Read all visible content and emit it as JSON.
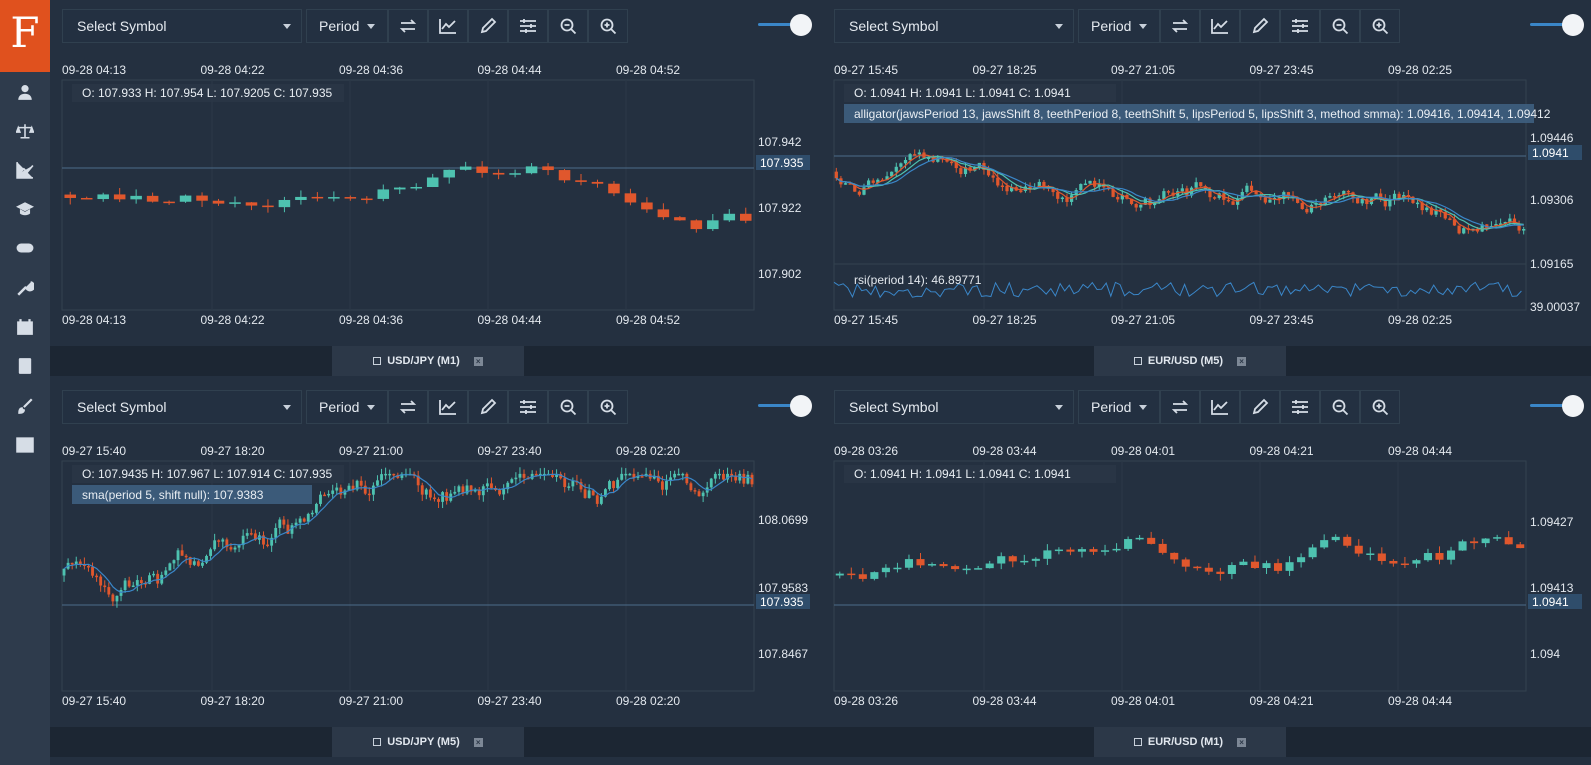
{
  "app": {
    "logo_letter": "F"
  },
  "sidebar": {
    "items": [
      {
        "name": "user",
        "icon": "user-icon"
      },
      {
        "name": "balance",
        "icon": "scale-icon"
      },
      {
        "name": "chart",
        "icon": "line-chart-icon"
      },
      {
        "name": "education",
        "icon": "graduation-cap-icon"
      },
      {
        "name": "games",
        "icon": "gamepad-icon"
      },
      {
        "name": "tools",
        "icon": "wrench-icon"
      },
      {
        "name": "calendar",
        "icon": "calendar-icon"
      },
      {
        "name": "book",
        "icon": "book-icon"
      },
      {
        "name": "paint",
        "icon": "brush-icon"
      },
      {
        "name": "table",
        "icon": "table-icon"
      }
    ]
  },
  "toolbar": {
    "symbol_placeholder": "Select Symbol",
    "period_label": "Period",
    "buttons": [
      "swap-icon",
      "area-chart-icon",
      "pencil-icon",
      "sliders-icon",
      "zoom-out-icon",
      "zoom-in-icon"
    ]
  },
  "colors": {
    "up": "#4ec2b0",
    "down": "#e0572d",
    "accent": "#e0511e",
    "line": "#3a86c8"
  },
  "charts": [
    {
      "id": "p1",
      "tab": "USD/JPY (M1)",
      "top_times": [
        "09-28 04:13",
        "09-28 04:22",
        "09-28 04:36",
        "09-28 04:44",
        "09-28 04:52"
      ],
      "bottom_times": [
        "09-28 04:13",
        "09-28 04:22",
        "09-28 04:36",
        "09-28 04:44",
        "09-28 04:52"
      ],
      "ohlc": "O: 107.933 H: 107.954 L: 107.9205 C: 107.935",
      "indicator": "",
      "price_ticks": [
        "107.942",
        "107.922",
        "107.902"
      ],
      "last_price": "107.935"
    },
    {
      "id": "p2",
      "tab": "EUR/USD (M5)",
      "top_times": [
        "09-27 15:45",
        "09-27 18:25",
        "09-27 21:05",
        "09-27 23:45",
        "09-28 02:25"
      ],
      "bottom_times": [
        "09-27 15:45",
        "09-27 18:25",
        "09-27 21:05",
        "09-27 23:45",
        "09-28 02:25"
      ],
      "ohlc": "O: 1.0941 H: 1.0941 L: 1.0941 C: 1.0941",
      "indicator": "alligator(jawsPeriod 13, jawsShift 8, teethPeriod 8, teethShift 5, lipsPeriod 5, lipsShift 3, method smma): 1.09416, 1.09414, 1.09412",
      "price_ticks": [
        "1.09446",
        "1.09306",
        "1.09165"
      ],
      "last_price": "1.0941",
      "rsi_label": "rsi(period 14): 46.89771",
      "rsi_tick": "39.00037"
    },
    {
      "id": "p3",
      "tab": "USD/JPY (M5)",
      "top_times": [
        "09-27 15:40",
        "09-27 18:20",
        "09-27 21:00",
        "09-27 23:40",
        "09-28 02:20"
      ],
      "bottom_times": [
        "09-27 15:40",
        "09-27 18:20",
        "09-27 21:00",
        "09-27 23:40",
        "09-28 02:20"
      ],
      "ohlc": "O: 107.9435 H: 107.967 L: 107.914 C: 107.935",
      "indicator": "sma(period 5, shift null): 107.9383",
      "price_ticks": [
        "108.0699",
        "107.9583",
        "107.8467"
      ],
      "last_price": "107.935"
    },
    {
      "id": "p4",
      "tab": "EUR/USD (M1)",
      "top_times": [
        "09-28 03:26",
        "09-28 03:44",
        "09-28 04:01",
        "09-28 04:21",
        "09-28 04:44"
      ],
      "bottom_times": [
        "09-28 03:26",
        "09-28 03:44",
        "09-28 04:01",
        "09-28 04:21",
        "09-28 04:44"
      ],
      "ohlc": "O: 1.0941 H: 1.0941 L: 1.0941 C: 1.0941",
      "indicator": "",
      "price_ticks": [
        "1.09427",
        "1.09413",
        "1.094"
      ],
      "last_price": "1.0941"
    }
  ]
}
